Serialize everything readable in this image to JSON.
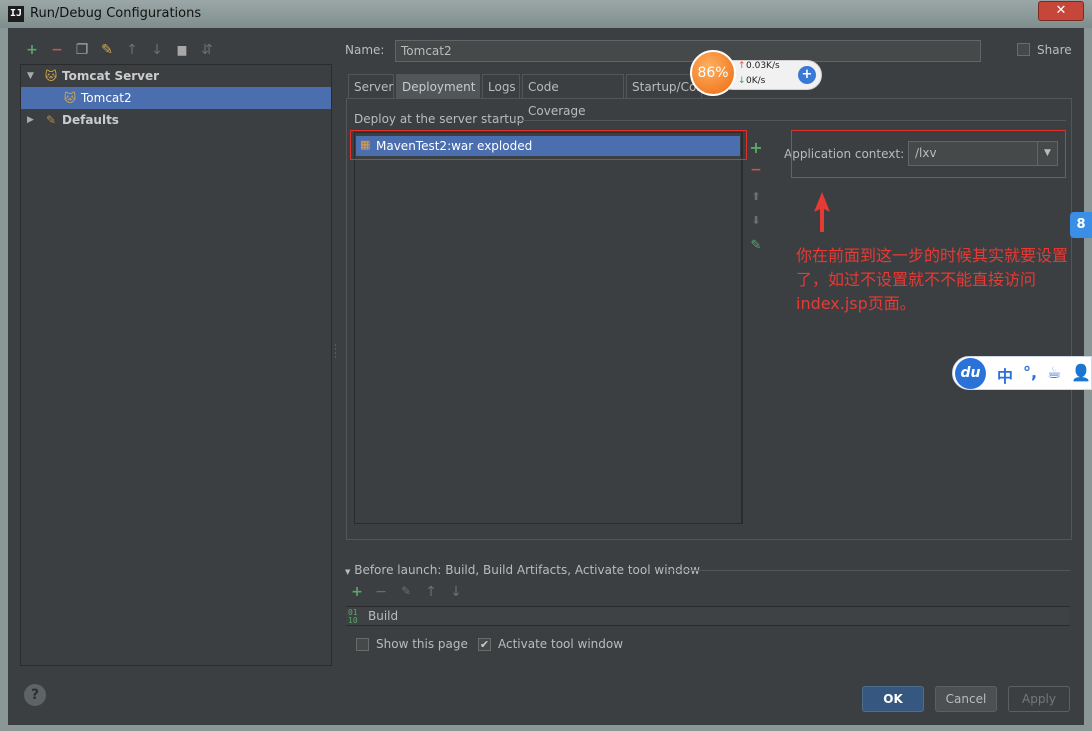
{
  "window": {
    "icon_text": "IJ",
    "title": "Run/Debug Configurations",
    "close_glyph": "✕"
  },
  "left_toolbar": [
    {
      "icon": "add-icon",
      "glyph": "+"
    },
    {
      "icon": "remove-icon",
      "glyph": "−"
    },
    {
      "icon": "copy-icon",
      "glyph": "❐"
    },
    {
      "icon": "wrench-icon",
      "glyph": "✎"
    },
    {
      "icon": "move-up-icon",
      "glyph": "↑"
    },
    {
      "icon": "move-down-icon",
      "glyph": "↓"
    },
    {
      "icon": "folder-icon",
      "glyph": "▆"
    },
    {
      "icon": "sort-icon",
      "glyph": "⇵"
    }
  ],
  "tree": {
    "tomcat_server": {
      "label": "Tomcat Server",
      "expand_glyph": "▼",
      "icon": "tomcat-icon"
    },
    "tomcat2": {
      "label": "Tomcat2",
      "icon": "tomcat-icon"
    },
    "defaults": {
      "label": "Defaults",
      "expand_glyph": "▶",
      "icon": "wrench-icon"
    }
  },
  "help_glyph": "?",
  "name_field": {
    "label": "Name:",
    "value": "Tomcat2"
  },
  "share": {
    "label": "Share",
    "checked": false
  },
  "tabs": [
    {
      "label": "Server",
      "active": false
    },
    {
      "label": "Deployment",
      "active": true
    },
    {
      "label": "Logs",
      "active": false
    },
    {
      "label": "Code Coverage",
      "active": false
    },
    {
      "label": "Startup/Cor",
      "active": false
    }
  ],
  "deployment": {
    "group_title": "Deploy at the server startup",
    "items": [
      {
        "label": "MavenTest2:war exploded",
        "icon": "artifact-icon"
      }
    ],
    "side_buttons": [
      {
        "icon": "add-icon",
        "glyph": "+"
      },
      {
        "icon": "remove-icon",
        "glyph": "−"
      },
      {
        "icon": "move-up-icon",
        "glyph": "⬆"
      },
      {
        "icon": "move-down-icon",
        "glyph": "⬇"
      },
      {
        "icon": "edit-icon",
        "glyph": "✎"
      }
    ],
    "app_context": {
      "label": "Application context:",
      "value": "/lxv",
      "arrow": "▼"
    }
  },
  "annotation": {
    "color": "#e63a35",
    "text": "你在前面到这一步的时候其实就要设置了，如过不设置就不不能直接访问index.jsp页面。"
  },
  "before_launch": {
    "title": "Before launch: Build, Build Artifacts, Activate tool window",
    "expand_glyph": "▼",
    "tools": [
      {
        "icon": "add-icon",
        "glyph": "+"
      },
      {
        "icon": "remove-icon",
        "glyph": "−"
      },
      {
        "icon": "edit-icon",
        "glyph": "✎"
      },
      {
        "icon": "move-up-icon",
        "glyph": "↑"
      },
      {
        "icon": "move-down-icon",
        "glyph": "↓"
      }
    ],
    "items": [
      {
        "label": "Build",
        "icon": "build-icon",
        "icon_text": "01\n10"
      }
    ]
  },
  "checkboxes": {
    "show_page": {
      "label": "Show this page",
      "checked": false
    },
    "activate_tool": {
      "label": "Activate tool window",
      "checked": true,
      "check_glyph": "✔"
    }
  },
  "buttons": {
    "ok": "OK",
    "cancel": "Cancel",
    "apply": "Apply"
  },
  "net_monitor": {
    "percent": "86%",
    "upload": "0.03K/s",
    "download": "0K/s",
    "up_arrow": "↑",
    "down_arrow": "↓",
    "plus": "+"
  },
  "side_tab_glyph": "8",
  "ime_bar": {
    "logo": "du",
    "items": [
      "中",
      "°,",
      "☕",
      "👤"
    ]
  }
}
